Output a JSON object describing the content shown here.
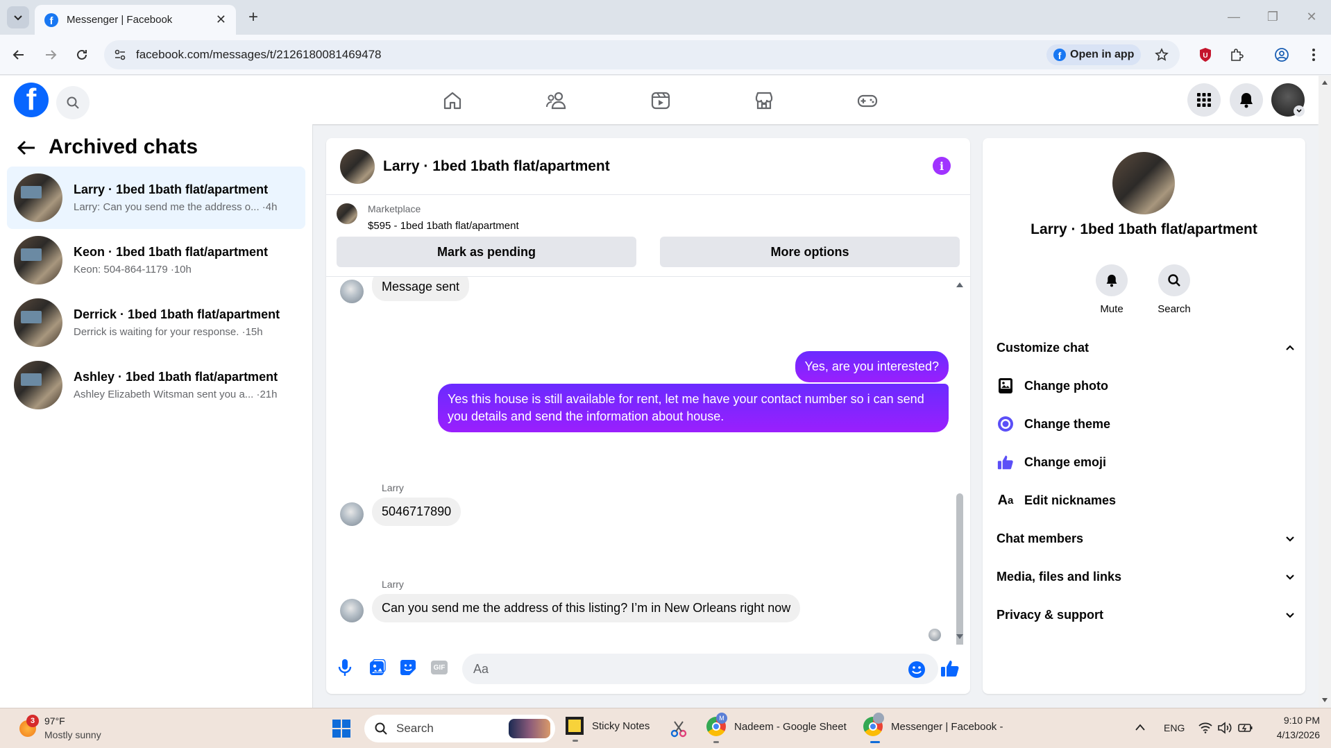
{
  "browser": {
    "tab_title": "Messenger | Facebook",
    "url": "facebook.com/messages/t/2126180081469478",
    "open_in_app": "Open in app"
  },
  "header": {
    "logo": "f"
  },
  "sidebar": {
    "title": "Archived chats",
    "chats": [
      {
        "name": "Larry · 1bed 1bath flat/apartment",
        "snippet": "Larry: Can you send me the address o... ·4h"
      },
      {
        "name": "Keon · 1bed 1bath flat/apartment",
        "snippet": "Keon: 504-864-1179 ·10h"
      },
      {
        "name": "Derrick · 1bed 1bath flat/apartment",
        "snippet": "Derrick is waiting for your response. ·15h"
      },
      {
        "name": "Ashley · 1bed 1bath flat/apartment",
        "snippet": "Ashley Elizabeth Witsman sent you a... ·21h"
      }
    ]
  },
  "chat": {
    "title": "Larry · 1bed 1bath flat/apartment",
    "marketplace_label": "Marketplace",
    "marketplace_item": "$595 - 1bed 1bath flat/apartment",
    "mark_pending": "Mark as pending",
    "more_options": "More options",
    "messages": [
      {
        "from": "in",
        "text": "Message sent"
      },
      {
        "from": "out",
        "text": "Yes, are you interested?"
      },
      {
        "from": "out",
        "text": "Yes this house is still available for rent, let me have your contact number so i can send you details and send the information about house."
      },
      {
        "from": "in",
        "sender": "Larry",
        "text": "5046717890"
      },
      {
        "from": "in",
        "sender": "Larry",
        "text": "Can you send me the address of this listing? I’m in New Orleans right now"
      }
    ],
    "composer_placeholder": "Aa"
  },
  "details": {
    "name": "Larry · 1bed 1bath flat/apartment",
    "mute": "Mute",
    "search": "Search",
    "customize_chat": "Customize chat",
    "change_photo": "Change photo",
    "change_theme": "Change theme",
    "change_emoji": "Change emoji",
    "edit_nicknames": "Edit nicknames",
    "chat_members": "Chat members",
    "media_files_links": "Media, files and links",
    "privacy_support": "Privacy & support"
  },
  "taskbar": {
    "weather_badge": "3",
    "temperature": "97°F",
    "weather": "Mostly sunny",
    "search": "Search",
    "apps": [
      "Sticky Notes",
      "Nadeem - Google Sheet",
      "Messenger | Facebook -"
    ],
    "language": "ENG",
    "time": "9:10 PM",
    "date": "4/13/2026"
  },
  "colors": {
    "fb_blue": "#0866ff",
    "accent_purple": "#8223ff"
  }
}
